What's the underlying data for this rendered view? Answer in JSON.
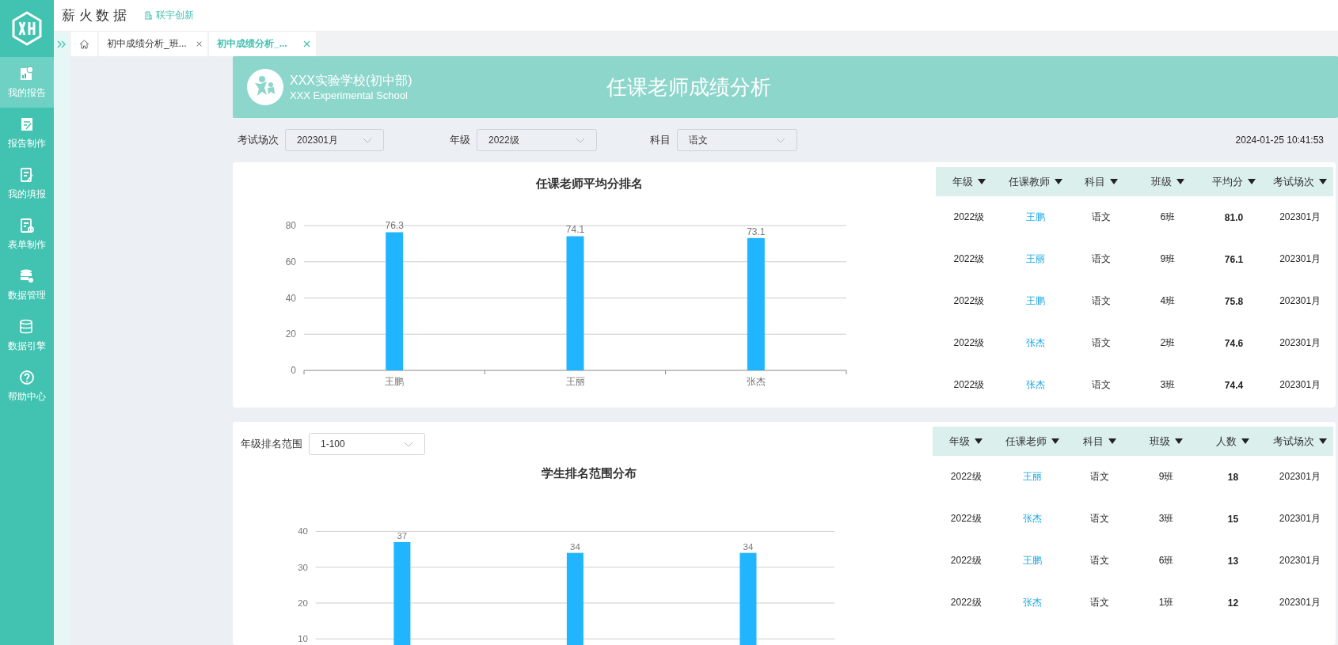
{
  "app": {
    "title": "薪 火 数 据",
    "brand": "联宇创新"
  },
  "sidebar": {
    "items": [
      {
        "label": "我的报告",
        "selected": true
      },
      {
        "label": "报告制作",
        "selected": false
      },
      {
        "label": "我的填报",
        "selected": false
      },
      {
        "label": "表单制作",
        "selected": false
      },
      {
        "label": "数据管理",
        "selected": false
      },
      {
        "label": "数据引擎",
        "selected": false
      },
      {
        "label": "帮助中心",
        "selected": false
      }
    ]
  },
  "tabs": [
    {
      "label": "初中成绩分析_班...",
      "selected": false
    },
    {
      "label": "初中成绩分析_...",
      "selected": true
    }
  ],
  "banner": {
    "school": "XXX实验学校(初中部)",
    "school_en": "XXX Experimental School",
    "title": "任课老师成绩分析"
  },
  "filters": [
    {
      "label": "考试场次",
      "value": "202301月"
    },
    {
      "label": "年级",
      "value": "2022级"
    },
    {
      "label": "科目",
      "value": "语文"
    }
  ],
  "timestamp": "2024-01-25 10:41:53",
  "teacher_panel": {
    "chart_data": {
      "type": "bar",
      "title": "任课老师平均分排名",
      "categories": [
        "王鹏",
        "王丽",
        "张杰"
      ],
      "values": [
        76.3,
        74.1,
        73.1
      ],
      "ylim": [
        0,
        80
      ],
      "yticks": [
        0,
        20,
        40,
        60,
        80
      ],
      "grid": true,
      "data_labels": true
    },
    "table": {
      "columns": [
        {
          "label": "年级",
          "kind": "text"
        },
        {
          "label": "任课教师",
          "kind": "link"
        },
        {
          "label": "科目",
          "kind": "text"
        },
        {
          "label": "班级",
          "kind": "text"
        },
        {
          "label": "平均分",
          "kind": "bold"
        },
        {
          "label": "考试场次",
          "kind": "text"
        }
      ],
      "rows": [
        [
          "2022级",
          "王鹏",
          "语文",
          "6班",
          "81.0",
          "202301月"
        ],
        [
          "2022级",
          "王丽",
          "语文",
          "9班",
          "76.1",
          "202301月"
        ],
        [
          "2022级",
          "王鹏",
          "语文",
          "4班",
          "75.8",
          "202301月"
        ],
        [
          "2022级",
          "张杰",
          "语文",
          "2班",
          "74.6",
          "202301月"
        ],
        [
          "2022级",
          "张杰",
          "语文",
          "3班",
          "74.4",
          "202301月"
        ]
      ]
    }
  },
  "rank_panel": {
    "filter": {
      "label": "年级排名范围",
      "value": "1-100"
    },
    "chart_data": {
      "type": "bar",
      "title": "学生排名范围分布",
      "values": [
        37,
        34,
        34
      ],
      "ylim": [
        0,
        40
      ],
      "yticks": [
        10,
        20,
        30,
        40
      ],
      "grid": true,
      "data_labels": true
    },
    "table": {
      "columns": [
        {
          "label": "年级",
          "kind": "text"
        },
        {
          "label": "任课老师",
          "kind": "link"
        },
        {
          "label": "科目",
          "kind": "text"
        },
        {
          "label": "班级",
          "kind": "text"
        },
        {
          "label": "人数",
          "kind": "bold"
        },
        {
          "label": "考试场次",
          "kind": "text"
        }
      ],
      "rows": [
        [
          "2022级",
          "王丽",
          "语文",
          "9班",
          "18",
          "202301月"
        ],
        [
          "2022级",
          "张杰",
          "语文",
          "3班",
          "15",
          "202301月"
        ],
        [
          "2022级",
          "王鹏",
          "语文",
          "6班",
          "13",
          "202301月"
        ],
        [
          "2022级",
          "张杰",
          "语文",
          "1班",
          "12",
          "202301月"
        ]
      ]
    }
  }
}
